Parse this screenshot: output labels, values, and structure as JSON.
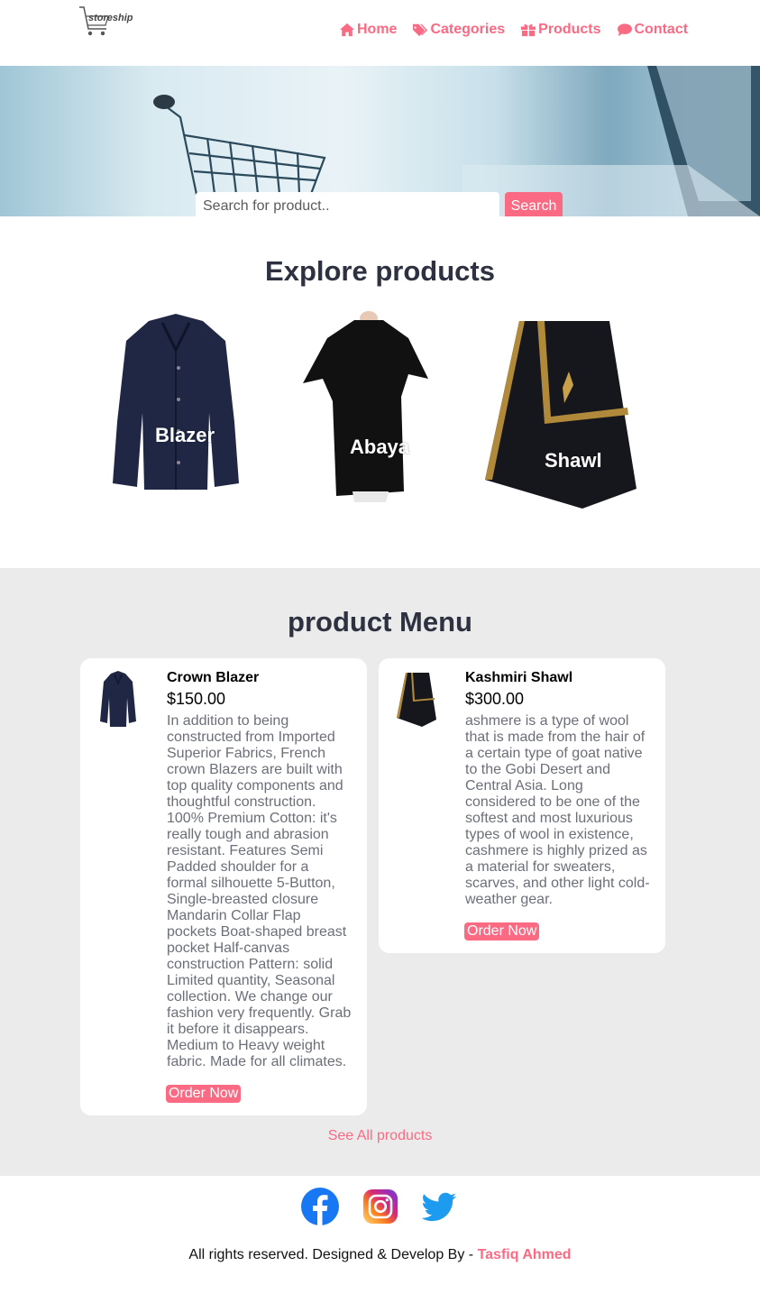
{
  "header": {
    "logo_text": "storeship",
    "nav": [
      {
        "label": "Home",
        "icon": "home-icon"
      },
      {
        "label": "Categories",
        "icon": "tags-icon"
      },
      {
        "label": "Products",
        "icon": "gift-icon"
      },
      {
        "label": "Contact",
        "icon": "comment-icon"
      }
    ]
  },
  "hero": {
    "search_placeholder": "Search for product..",
    "search_button": "Search"
  },
  "explore": {
    "title": "Explore products",
    "products": [
      {
        "label": "Blazer"
      },
      {
        "label": "Abaya"
      },
      {
        "label": "Shawl"
      }
    ]
  },
  "menu": {
    "title": "product Menu",
    "items": [
      {
        "name": "Crown Blazer",
        "price": "$150.00",
        "description": "In addition to being constructed from Imported Superior Fabrics, French crown Blazers are built with top quality components and thoughtful construction. 100% Premium Cotton: it's really tough and abrasion resistant. Features Semi Padded shoulder for a formal silhouette 5-Button, Single-breasted closure Mandarin Collar Flap pockets Boat-shaped breast pocket Half-canvas construction Pattern: solid Limited quantity, Seasonal collection. We change our fashion very frequently. Grab it before it disappears. Medium to Heavy weight fabric. Made for all climates.",
        "button": "Order Now"
      },
      {
        "name": "Kashmiri Shawl",
        "price": "$300.00",
        "description": "ashmere is a type of wool that is made from the hair of a certain type of goat native to the Gobi Desert and Central Asia. Long considered to be one of the softest and most luxurious types of wool in existence, cashmere is highly prized as a material for sweaters, scarves, and other light cold-weather gear.",
        "button": "Order Now"
      }
    ],
    "see_all": "See All products"
  },
  "footer": {
    "social": [
      "facebook-icon",
      "instagram-icon",
      "twitter-icon"
    ],
    "text": "All rights reserved. Designed & Develop By - ",
    "author": "Tasfiq Ahmed"
  },
  "colors": {
    "accent": "#fa6a83",
    "heading": "#2d3140",
    "menu_bg": "#ebebeb"
  }
}
